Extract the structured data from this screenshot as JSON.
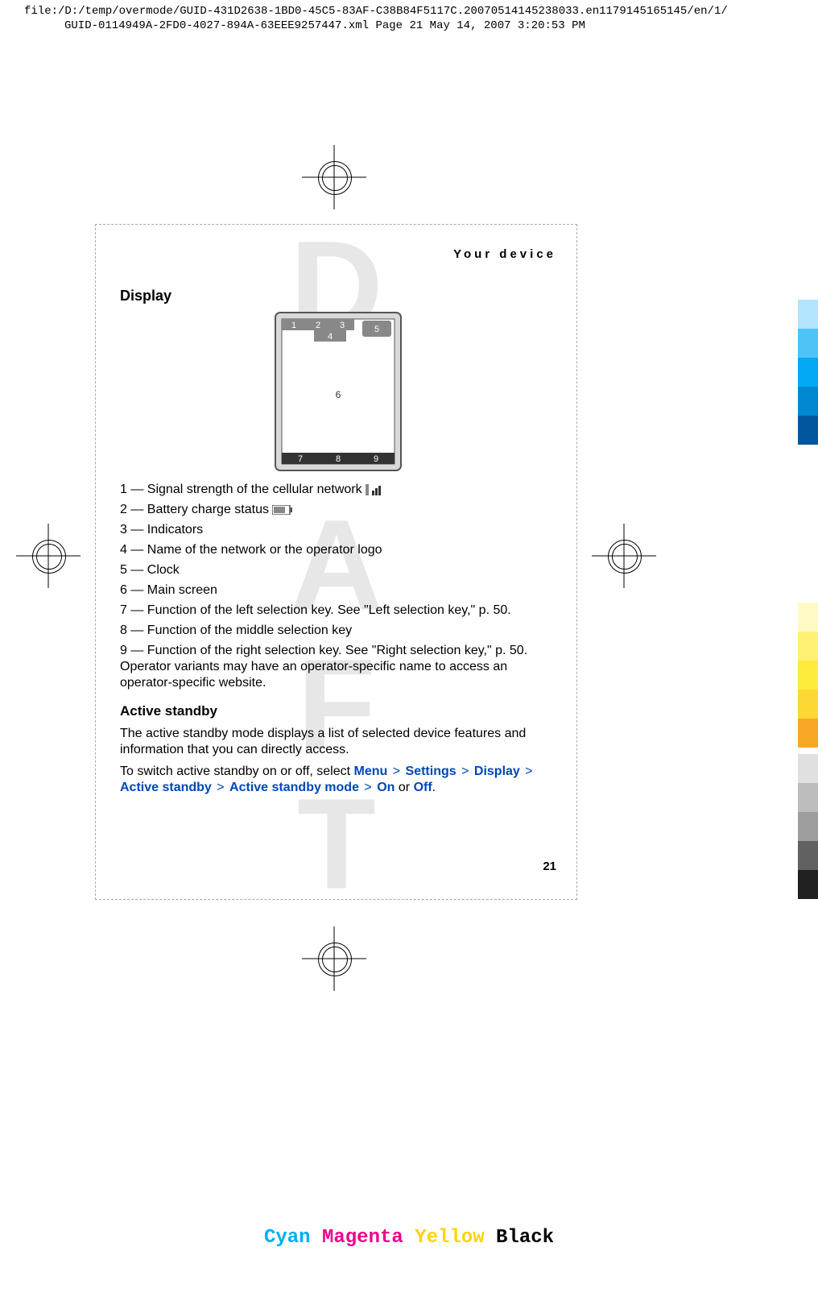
{
  "meta": {
    "line1": "file:/D:/temp/overmode/GUID-431D2638-1BD0-45C5-83AF-C38B84F5117C.20070514145238033.en1179145165145/en/1/",
    "line2": "GUID-0114949A-2FD0-4027-894A-63EEE9257447.xml    Page 21    May 14, 2007 3:20:53 PM"
  },
  "section_header": "Your device",
  "watermark": "DRAFT",
  "headings": {
    "display": "Display",
    "active_standby": "Active standby"
  },
  "diagram_labels": [
    "1",
    "2",
    "3",
    "4",
    "5",
    "6",
    "7",
    "8",
    "9"
  ],
  "display_items": [
    "1 — Signal strength of the cellular network ",
    "2 — Battery charge status ",
    "3 — Indicators",
    "4 — Name of the network or the operator logo",
    "5 — Clock",
    "6 — Main screen",
    "7 — Function of the left selection key. See \"Left selection key,\" p. 50.",
    "8 — Function of the middle selection key",
    "9 — Function of the right selection key. See \"Right selection key,\" p. 50. Operator variants may have an operator-specific name to access an operator-specific website."
  ],
  "active_standby_text": "The active standby mode displays a list of selected device features and information that you can directly access.",
  "switch_text_prefix": "To switch active standby on or off, select ",
  "menu_path": [
    "Menu",
    "Settings",
    "Display",
    "Active standby",
    "Active standby mode",
    "On"
  ],
  "switch_text_or": " or ",
  "switch_text_off": "Off",
  "switch_text_suffix": ".",
  "page_number": "21",
  "footer": {
    "c": "Cyan",
    "m": "Magenta",
    "y": "Yellow",
    "k": "Black"
  },
  "side_colors_top": [
    "#b3e5fc",
    "#4fc3f7",
    "#03a9f4",
    "#0288d1",
    "#01579b"
  ],
  "side_colors_mid": [
    "#fff9c4",
    "#fff176",
    "#ffeb3b",
    "#fdd835",
    "#f9a825"
  ],
  "side_colors_bot": [
    "#e0e0e0",
    "#bdbdbd",
    "#9e9e9e",
    "#616161",
    "#212121"
  ]
}
